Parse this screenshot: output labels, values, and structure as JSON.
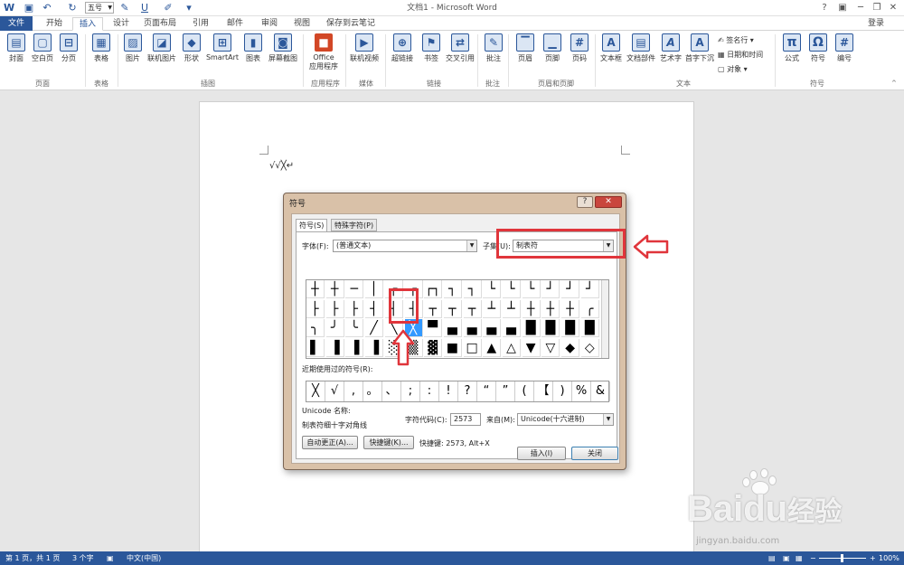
{
  "window": {
    "title": "文档1 - Microsoft Word",
    "font_size": "五号",
    "login": "登录"
  },
  "tabs": [
    "文件",
    "开始",
    "插入",
    "设计",
    "页面布局",
    "引用",
    "邮件",
    "审阅",
    "视图",
    "保存到云笔记"
  ],
  "ribbon": {
    "buttons": [
      {
        "label": "封面",
        "icon": "cover-page-icon",
        "glyph": "▤"
      },
      {
        "label": "空白页",
        "icon": "blank-page-icon",
        "glyph": "▢"
      },
      {
        "label": "分页",
        "icon": "page-break-icon",
        "glyph": "⊟"
      },
      {
        "label": "表格",
        "icon": "table-icon",
        "glyph": "▦"
      },
      {
        "label": "图片",
        "icon": "picture-icon",
        "glyph": "▨"
      },
      {
        "label": "联机图片",
        "icon": "online-picture-icon",
        "glyph": "◪"
      },
      {
        "label": "形状",
        "icon": "shapes-icon",
        "glyph": "◆"
      },
      {
        "label": "SmartArt",
        "icon": "smartart-icon",
        "glyph": "⊞"
      },
      {
        "label": "图表",
        "icon": "chart-icon",
        "glyph": "▮"
      },
      {
        "label": "屏幕截图",
        "icon": "screenshot-icon",
        "glyph": "◙"
      },
      {
        "label": "Office",
        "icon": "office-apps-icon",
        "glyph": "■"
      },
      {
        "label": "联机视频",
        "icon": "online-video-icon",
        "glyph": "▶"
      },
      {
        "label": "超链接",
        "icon": "hyperlink-icon",
        "glyph": "⊕"
      },
      {
        "label": "书签",
        "icon": "bookmark-icon",
        "glyph": "⚑"
      },
      {
        "label": "交叉引用",
        "icon": "cross-reference-icon",
        "glyph": "⇄"
      },
      {
        "label": "批注",
        "icon": "comment-icon",
        "glyph": "✎"
      },
      {
        "label": "页眉",
        "icon": "header-icon",
        "glyph": "▔"
      },
      {
        "label": "页脚",
        "icon": "footer-icon",
        "glyph": "▁"
      },
      {
        "label": "页码",
        "icon": "page-number-icon",
        "glyph": "#"
      },
      {
        "label": "文本框",
        "icon": "textbox-icon",
        "glyph": "A"
      },
      {
        "label": "文档部件",
        "icon": "quick-parts-icon",
        "glyph": "▤"
      },
      {
        "label": "艺术字",
        "icon": "wordart-icon",
        "glyph": "A"
      },
      {
        "label": "首字下沉",
        "icon": "drop-cap-icon",
        "glyph": "A"
      },
      {
        "label": "公式",
        "icon": "equation-icon",
        "glyph": "π"
      },
      {
        "label": "符号",
        "icon": "symbol-icon",
        "glyph": "Ω"
      },
      {
        "label": "编号",
        "icon": "numbering-icon",
        "glyph": "#"
      }
    ],
    "office_sub": "应用程序",
    "small": [
      "签名行",
      "日期和时间",
      "对象"
    ],
    "groups": [
      "页面",
      "表格",
      "插图",
      "应用程序",
      "媒体",
      "链接",
      "批注",
      "页眉和页脚",
      "文本",
      "符号"
    ]
  },
  "document": {
    "text": "√√╳↵"
  },
  "dialog": {
    "title": "符号",
    "help": "?",
    "close": "✕",
    "tabs": [
      "符号(S)",
      "特殊字符(P)"
    ],
    "font_label": "字体(F):",
    "font_value": "(普通文本)",
    "subset_label": "子集(U):",
    "subset_value": "制表符",
    "grid_rows": [
      [
        "┼",
        "┼",
        "─",
        "│",
        "┌",
        "┌",
        "┌┐",
        "┐",
        "┐",
        "└",
        "└",
        "└",
        "┘",
        "┘",
        "┘"
      ],
      [
        "├",
        "├",
        "├",
        "┤",
        "┤",
        "┤",
        "┬",
        "┬",
        "┬",
        "┴",
        "┴",
        "┼",
        "┼",
        "┼",
        "╭"
      ],
      [
        "╮",
        "╯",
        "╰",
        "╱",
        "╲",
        "╳",
        "▀",
        "▄",
        "▄",
        "▄",
        "▄",
        "█",
        "█",
        "█",
        "█"
      ],
      [
        "▌",
        "▐",
        "▐",
        "▐",
        "░",
        "▒",
        "▓",
        "■",
        "□",
        "▲",
        "△",
        "▼",
        "▽",
        "◆",
        "◇"
      ]
    ],
    "selected_cell": "╳",
    "recent_label": "近期使用过的符号(R):",
    "recent": [
      "╳",
      "√",
      ",",
      "。",
      "、",
      ";",
      ":",
      "!",
      "?",
      "“",
      "”",
      "(",
      "【",
      ")",
      "%",
      "&"
    ],
    "unicode_name_label": "Unicode 名称:",
    "unicode_name": "制表符细十字对角线",
    "charcode_label": "字符代码(C):",
    "charcode": "2573",
    "from_label": "来自(M):",
    "from_value": "Unicode(十六进制)",
    "autocorrect": "自动更正(A)...",
    "shortcut_key": "快捷键(K)...",
    "shortcut_text": "快捷键: 2573, Alt+X",
    "insert": "插入(I)",
    "close_btn": "关闭"
  },
  "status": {
    "page": "第 1 页，共 1 页",
    "words": "3 个字",
    "lang": "中文(中国)",
    "zoom": "100%"
  },
  "watermark": {
    "brand": "Bai",
    "brand2": "du",
    "cn": "经验",
    "url": "jingyan.baidu.com"
  },
  "colors": {
    "accent": "#2b579a",
    "highlight": "#e0353b",
    "dialog_frame": "#d9c1a8",
    "selection": "#3399ff"
  }
}
